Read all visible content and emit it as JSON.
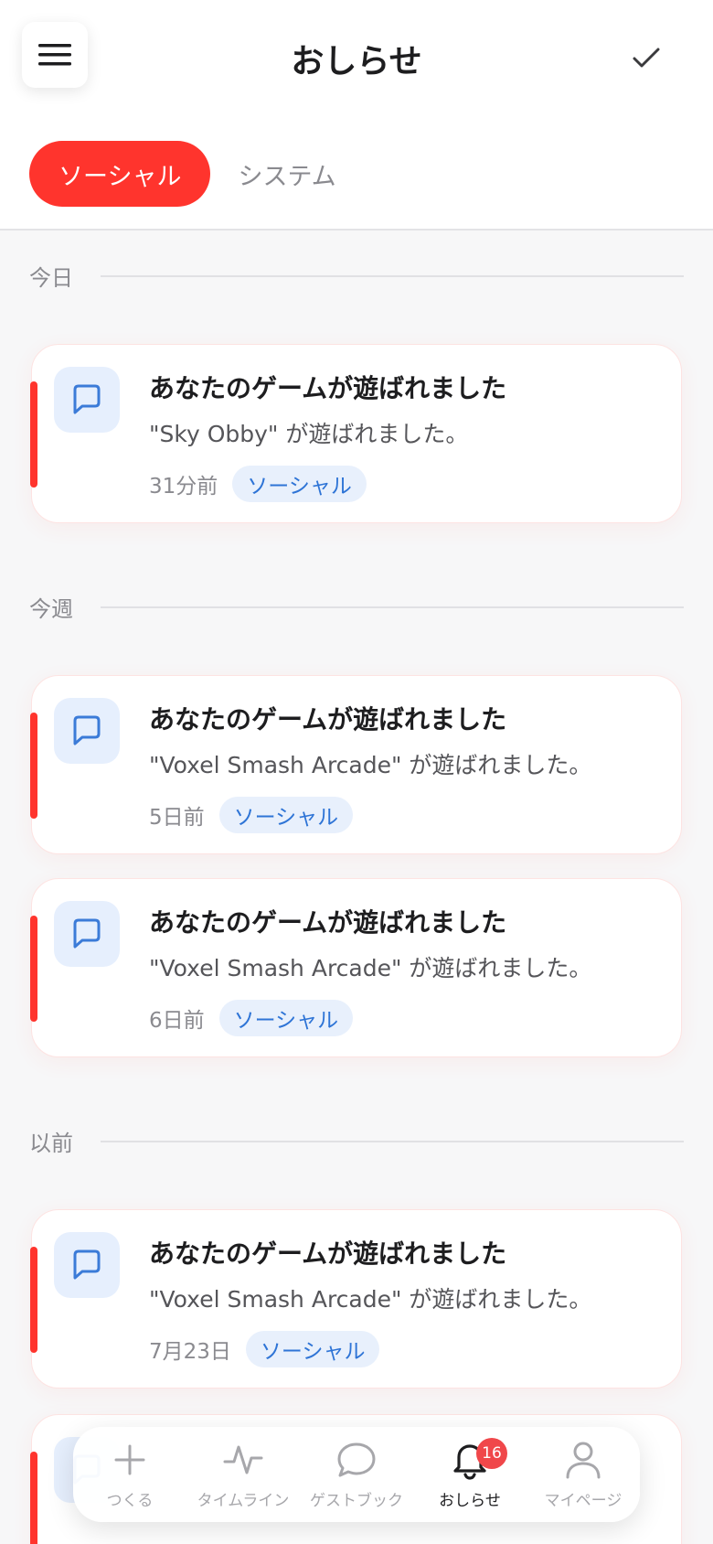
{
  "header": {
    "title": "おしらせ",
    "menu_icon": "hamburger-menu-icon",
    "check_icon": "checkmark-icon"
  },
  "tabs": [
    {
      "label": "ソーシャル",
      "active": true
    },
    {
      "label": "システム",
      "active": false
    }
  ],
  "sections": [
    {
      "label": "今日"
    },
    {
      "label": "今週"
    },
    {
      "label": "以前"
    }
  ],
  "notifications": [
    {
      "title": "あなたのゲームが遊ばれました",
      "body": "\"Sky Obby\" が遊ばれました。",
      "time": "31分前",
      "tag": "ソーシャル"
    },
    {
      "title": "あなたのゲームが遊ばれました",
      "body": "\"Voxel Smash Arcade\" が遊ばれました。",
      "time": "5日前",
      "tag": "ソーシャル"
    },
    {
      "title": "あなたのゲームが遊ばれました",
      "body": "\"Voxel Smash Arcade\" が遊ばれました。",
      "time": "6日前",
      "tag": "ソーシャル"
    },
    {
      "title": "あなたのゲームが遊ばれました",
      "body": "\"Voxel Smash Arcade\" が遊ばれました。",
      "time": "7月23日",
      "tag": "ソーシャル"
    },
    {
      "title": "",
      "body": "",
      "time": "",
      "tag": ""
    }
  ],
  "bottom_nav": [
    {
      "label": "つくる",
      "icon": "plus-icon",
      "active": false
    },
    {
      "label": "タイムライン",
      "icon": "activity-pulse-icon",
      "active": false
    },
    {
      "label": "ゲストブック",
      "icon": "chat-bubble-icon",
      "active": false
    },
    {
      "label": "おしらせ",
      "icon": "bell-icon",
      "active": true,
      "badge": "16"
    },
    {
      "label": "マイページ",
      "icon": "user-icon",
      "active": false
    }
  ],
  "colors": {
    "accent_red": "#ff342d",
    "chip_blue": "#2e74d6",
    "chip_bg": "#e8f0fc",
    "badge_red": "#f0474a"
  }
}
